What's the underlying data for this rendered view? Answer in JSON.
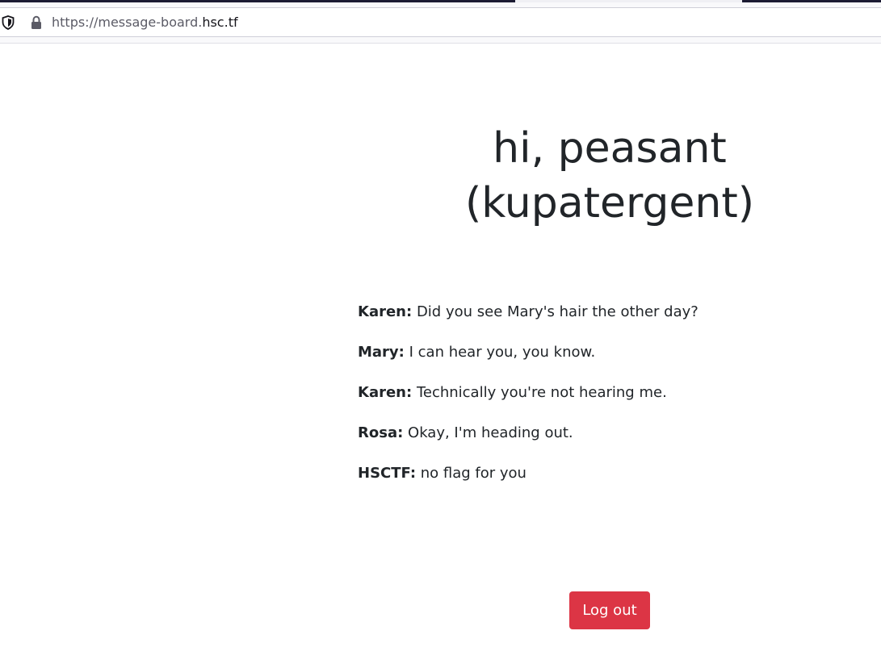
{
  "browser": {
    "url_prefix": "https://message-board.",
    "url_host": "hsc.tf"
  },
  "page": {
    "heading": "hi, peasant (kupatergent)",
    "messages": [
      {
        "author": "Karen:",
        "text": "Did you see Mary's hair the other day?"
      },
      {
        "author": "Mary:",
        "text": "I can hear you, you know."
      },
      {
        "author": "Karen:",
        "text": "Technically you're not hearing me."
      },
      {
        "author": "Rosa:",
        "text": "Okay, I'm heading out."
      },
      {
        "author": "HSCTF:",
        "text": "no flag for you"
      }
    ],
    "logout_label": "Log out"
  },
  "colors": {
    "button_danger": "#dc3545",
    "text": "#212529"
  }
}
